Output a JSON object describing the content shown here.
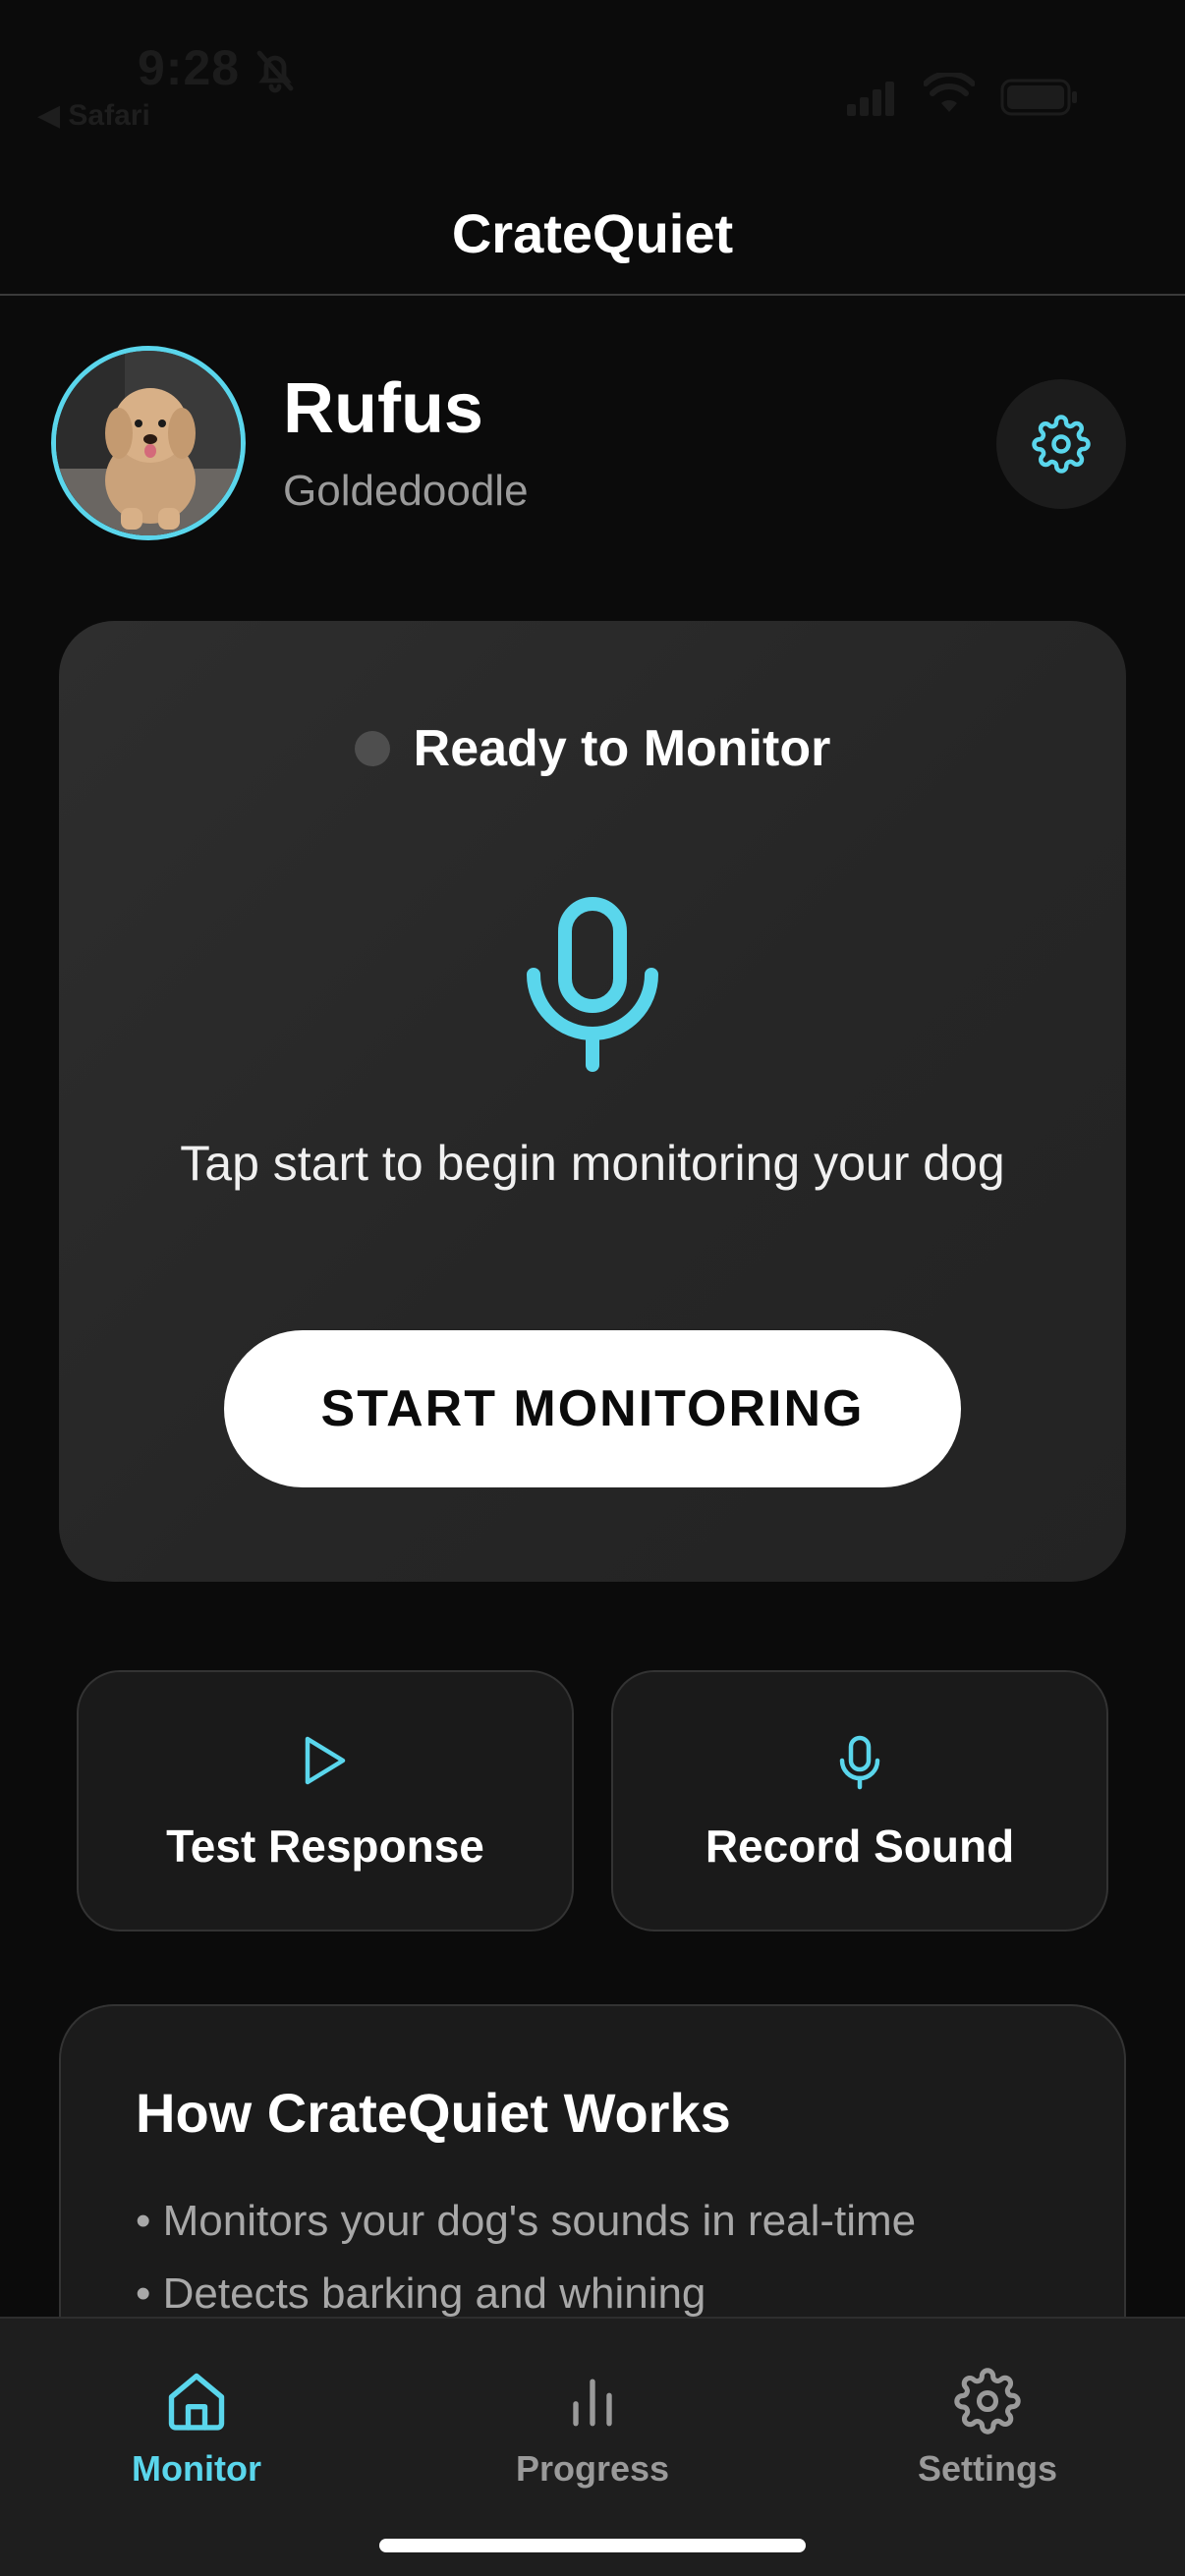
{
  "status_bar": {
    "time": "9:28",
    "back_label": "◀ Safari"
  },
  "header": {
    "title": "CrateQuiet"
  },
  "profile": {
    "name": "Rufus",
    "breed": "Goldedoodle"
  },
  "monitor": {
    "status": "Ready to Monitor",
    "hint": "Tap start to begin monitoring your dog",
    "start_label": "START MONITORING"
  },
  "actions": [
    {
      "label": "Test Response",
      "icon": "play-icon"
    },
    {
      "label": "Record Sound",
      "icon": "mic-icon"
    }
  ],
  "how_it_works": {
    "title": "How CrateQuiet Works",
    "items": [
      "• Monitors your dog's sounds in real-time",
      "• Detects barking and whining"
    ]
  },
  "tabs": [
    {
      "label": "Monitor",
      "icon": "home-icon",
      "active": true
    },
    {
      "label": "Progress",
      "icon": "bar-chart-icon",
      "active": false
    },
    {
      "label": "Settings",
      "icon": "gear-icon",
      "active": false
    }
  ],
  "colors": {
    "accent": "#5ad6ec",
    "background": "#0b0b0b",
    "card": "#2a2a2a",
    "inactive": "#9a9a9a"
  }
}
